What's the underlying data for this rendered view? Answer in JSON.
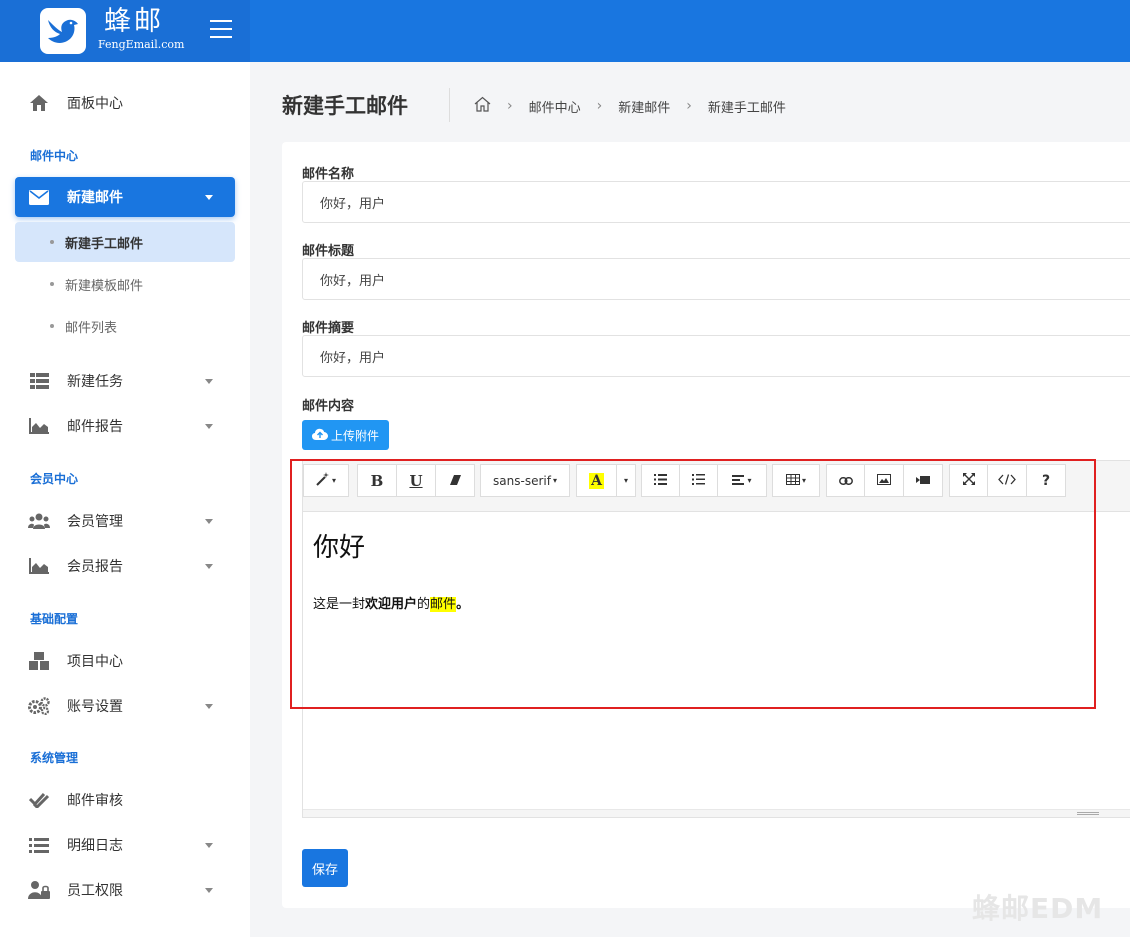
{
  "brand": {
    "name": "蜂邮",
    "sub": "FengEmail.com"
  },
  "sidebar": {
    "dashboard": "面板中心",
    "sections": {
      "mail": "邮件中心",
      "member": "会员中心",
      "config": "基础配置",
      "system": "系统管理"
    },
    "new_mail": "新建邮件",
    "sub_items": [
      "新建手工邮件",
      "新建模板邮件",
      "邮件列表"
    ],
    "new_task": "新建任务",
    "mail_report": "邮件报告",
    "member_mgmt": "会员管理",
    "member_report": "会员报告",
    "project_center": "项目中心",
    "account_settings": "账号设置",
    "mail_review": "邮件审核",
    "detail_log": "明细日志",
    "staff_perm": "员工权限"
  },
  "page": {
    "title": "新建手工邮件"
  },
  "breadcrumb": [
    "邮件中心",
    "新建邮件",
    "新建手工邮件"
  ],
  "form": {
    "name_label": "邮件名称",
    "name_value": "你好，用户",
    "subject_label": "邮件标题",
    "subject_value": "你好，用户",
    "summary_label": "邮件摘要",
    "summary_value": "你好，用户",
    "content_label": "邮件内容",
    "upload_label": "上传附件",
    "save_label": "保存"
  },
  "editor": {
    "font_name": "sans-serif",
    "heading": "你好",
    "body_prefix": "这是一封",
    "body_bold": "欢迎用户",
    "body_mid": "的",
    "body_highlight": "邮件",
    "body_end": "。",
    "highlight_color": "#ffff00"
  },
  "watermark": "蜂邮EDM",
  "colors": {
    "primary": "#1976e0",
    "accent": "#2196f3",
    "annotation": "#e02020"
  }
}
